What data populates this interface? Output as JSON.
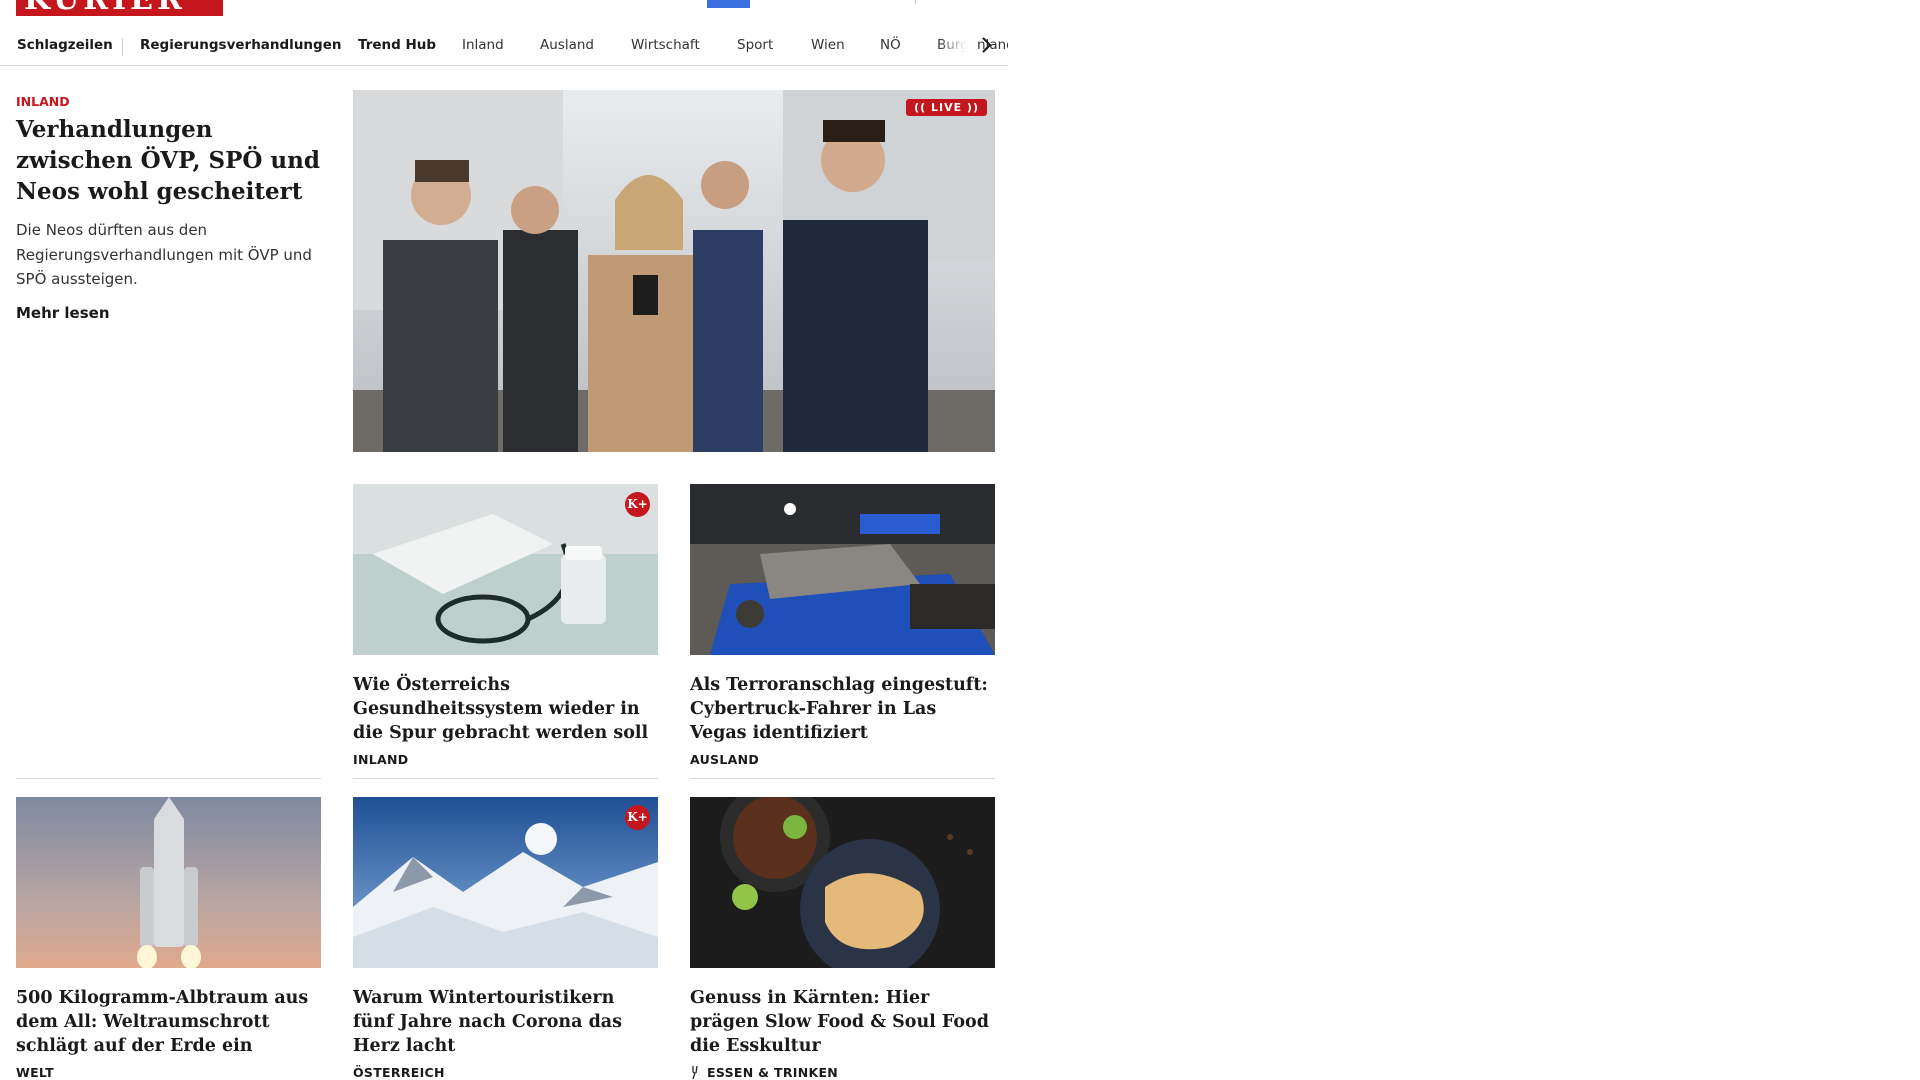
{
  "brand": {
    "logo_text": "KURIER",
    "accent_color": "#c4161c"
  },
  "nav": {
    "items": [
      {
        "label": "Schlagzeilen"
      },
      {
        "label": "Regierungsverhandlungen"
      },
      {
        "label": "Trend Hub"
      },
      {
        "label": "Inland"
      },
      {
        "label": "Ausland"
      },
      {
        "label": "Wirtschaft"
      },
      {
        "label": "Sport"
      },
      {
        "label": "Wien"
      },
      {
        "label": "NÖ"
      },
      {
        "label": "Burgenland"
      }
    ],
    "next_icon": "chevron-right-icon"
  },
  "lead": {
    "kicker": "INLAND",
    "title": "Verhandlungen zwischen ÖVP, SPÖ und Neos wohl gescheitert",
    "teaser": "Die Neos dürften aus den Regierungsverhandlungen mit ÖVP und SPÖ aussteigen.",
    "more": "Mehr lesen",
    "badge": "(( LIVE ))"
  },
  "cards": [
    {
      "title": "Wie Österreichs Gesundheitssys­tem wieder in die Spur gebracht werden soll",
      "category": "INLAND",
      "premium_badge": "K+"
    },
    {
      "title": "Als Terroranschlag eingestuft: Cy­bertruck-Fahrer in Las Vegas identifiziert",
      "category": "AUSLAND"
    },
    {
      "title": "500 Kilogramm-Albtraum aus dem All: Weltraumschrott schlägt auf der Erde ein",
      "category": "WELT"
    },
    {
      "title": "Warum Wintertouristikern fünf Jahre nach Corona das Herz lacht",
      "category": "ÖSTERREICH",
      "premium_badge": "K+"
    },
    {
      "title": "Genuss in Kärnten: Hier prägen Slow Food & Soul Food die Esskultur",
      "category": "ESSEN & TRINKEN",
      "category_icon": "fork-icon"
    }
  ]
}
